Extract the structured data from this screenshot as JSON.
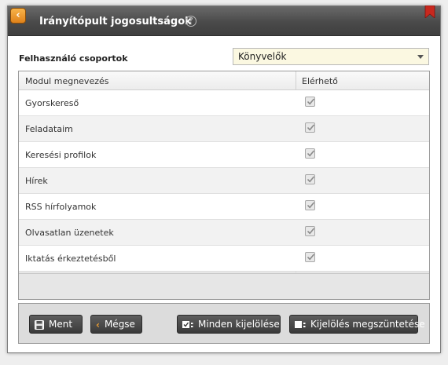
{
  "window": {
    "title": "Irányítópult jogosultságok",
    "back_icon": "chevron-left-icon",
    "help_icon": "question-circle-icon",
    "bookmark_icon": "bookmark-icon"
  },
  "form": {
    "group_label": "Felhasználó csoportok",
    "group_selected": "Könyvelők"
  },
  "grid": {
    "columns": [
      "Modul megnevezés",
      "Elérhető"
    ],
    "rows": [
      {
        "name": "Gyorskereső",
        "enabled": true
      },
      {
        "name": "Feladataim",
        "enabled": true
      },
      {
        "name": "Keresési profilok",
        "enabled": true
      },
      {
        "name": "Hírek",
        "enabled": true
      },
      {
        "name": "RSS hírfolyamok",
        "enabled": true
      },
      {
        "name": "Olvasatlan üzenetek",
        "enabled": true
      },
      {
        "name": "Iktatás érkeztetésből",
        "enabled": true
      }
    ]
  },
  "toolbar": {
    "save_label": "Ment",
    "cancel_label": "Mégse",
    "select_all_label": "Minden kijelölése",
    "deselect_label": "Kijelölés megszüntetése"
  },
  "colors": {
    "titlebar": "#4a4a4a",
    "accent_orange": "#e0821a",
    "bookmark_red": "#c8281e",
    "select_bg": "#fbf8e1"
  }
}
